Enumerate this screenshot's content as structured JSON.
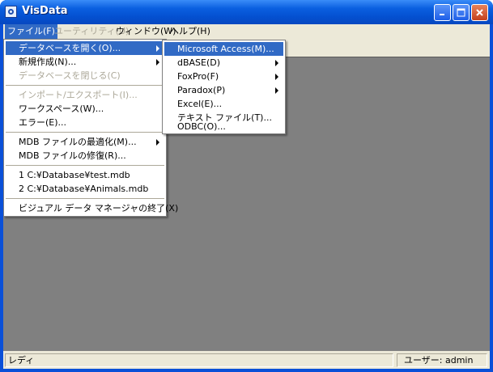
{
  "window": {
    "title": "VisData",
    "minimize": "0",
    "maximize": "1",
    "close": "r"
  },
  "menubar": {
    "file": "ファイル(F)",
    "utility": "ユーティリティ(U)",
    "window": "ウィンドウ(W)",
    "help": "ヘルプ(H)"
  },
  "file_menu": {
    "open_db": "データベースを開く(O)...",
    "new": "新規作成(N)...",
    "close_db": "データベースを閉じる(C)",
    "import_export": "インポート/エクスポート(I)...",
    "workspace": "ワークスペース(W)...",
    "error": "エラー(E)...",
    "compact": "MDB ファイルの最適化(M)...",
    "repair": "MDB ファイルの修復(R)...",
    "recent1": "1 C:¥Database¥test.mdb",
    "recent2": "2 C:¥Database¥Animals.mdb",
    "exit": "ビジュアル データ マネージャの終了(X)"
  },
  "open_submenu": {
    "access": "Microsoft Access(M)...",
    "dbase": "dBASE(D)",
    "foxpro": "FoxPro(F)",
    "paradox": "Paradox(P)",
    "excel": "Excel(E)...",
    "text": "テキスト ファイル(T)...",
    "odbc": "ODBC(O)..."
  },
  "status": {
    "ready": "レディ",
    "user": "ユーザー: admin"
  }
}
